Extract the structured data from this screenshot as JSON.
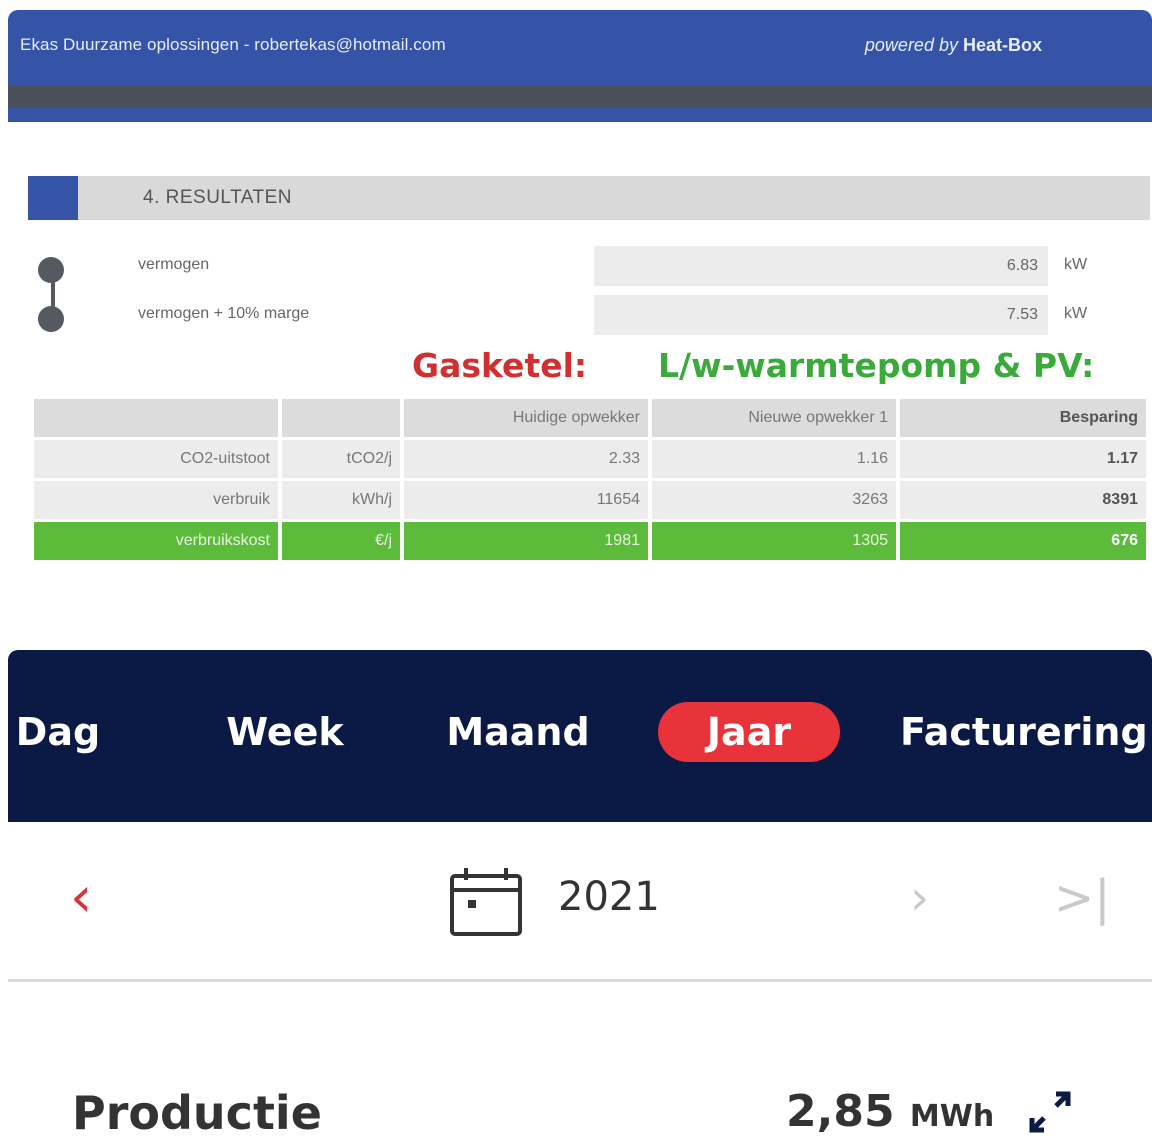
{
  "heatbox": {
    "company": "Ekas Duurzame oplossingen - robertekas@hotmail.com",
    "powered_prefix": "powered by",
    "powered_brand": "Heat-Box",
    "brand_color": "#3554a8",
    "section_title": "4. RESULTATEN",
    "power_rows": [
      {
        "label": "vermogen",
        "value": "6.83",
        "unit": "kW"
      },
      {
        "label": "vermogen + 10% marge",
        "value": "7.53",
        "unit": "kW"
      }
    ]
  },
  "overlays": {
    "gas": "Gasketel:",
    "heatpump": "L/w-warmtepomp & PV:",
    "gas_color": "#d03030",
    "heatpump_color": "#3aaa3a"
  },
  "results_table": {
    "headers": [
      "",
      "",
      "Huidige opwekker",
      "Nieuwe opwekker 1",
      "Besparing"
    ],
    "rows": [
      {
        "label": "CO2-uitstoot",
        "unit": "tCO2/j",
        "current": "2.33",
        "new": "1.16",
        "saving": "1.17"
      },
      {
        "label": "verbruik",
        "unit": "kWh/j",
        "current": "11654",
        "new": "3263",
        "saving": "8391"
      },
      {
        "label": "verbruikskost",
        "unit": "€/j",
        "current": "1981",
        "new": "1305",
        "saving": "676"
      }
    ],
    "highlight_color": "#5dbb3c"
  },
  "app": {
    "tabs": [
      {
        "label": "Dag",
        "active": false
      },
      {
        "label": "Week",
        "active": false
      },
      {
        "label": "Maand",
        "active": false
      },
      {
        "label": "Jaar",
        "active": true
      },
      {
        "label": "Facturering",
        "active": false
      }
    ],
    "nav_color": "#0b1a45",
    "active_tab_color": "#e8333b",
    "prev_icon": "chevron-left-icon",
    "prev_glyph": "‹",
    "calendar_icon": "calendar-icon",
    "year": "2021",
    "next_icon": "chevron-right-icon",
    "next_glyph": "›",
    "last_icon": "skip-to-end-icon",
    "last_glyph": ">|",
    "production_label": "Productie",
    "production_value": "2,85",
    "production_unit": "MWh",
    "expand_icon": "expand-icon"
  }
}
